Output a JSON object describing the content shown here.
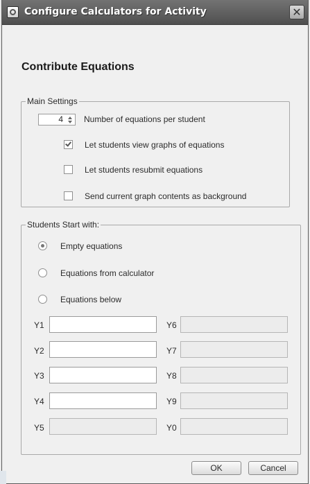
{
  "window": {
    "title": "Configure Calculators for Activity",
    "close_glyph": "✕",
    "icon": "calculator-window-icon"
  },
  "heading": "Contribute Equations",
  "main_settings": {
    "title": "Main Settings",
    "equations_per_student": {
      "value": "4",
      "label": "Number of equations per student"
    },
    "options": [
      {
        "label": "Let students view graphs of equations",
        "checked": true
      },
      {
        "label": "Let students resubmit equations",
        "checked": false
      },
      {
        "label": "Send current graph contents as background",
        "checked": false
      }
    ]
  },
  "start_with": {
    "title": "Students Start with:",
    "options": [
      {
        "label": "Empty equations",
        "selected": true
      },
      {
        "label": "Equations from calculator",
        "selected": false
      },
      {
        "label": "Equations below",
        "selected": false
      }
    ],
    "equations": {
      "left": [
        {
          "label": "Y1",
          "value": "",
          "enabled": true
        },
        {
          "label": "Y2",
          "value": "",
          "enabled": true
        },
        {
          "label": "Y3",
          "value": "",
          "enabled": true
        },
        {
          "label": "Y4",
          "value": "",
          "enabled": true
        },
        {
          "label": "Y5",
          "value": "",
          "enabled": false
        }
      ],
      "right": [
        {
          "label": "Y6",
          "value": "",
          "enabled": false
        },
        {
          "label": "Y7",
          "value": "",
          "enabled": false
        },
        {
          "label": "Y8",
          "value": "",
          "enabled": false
        },
        {
          "label": "Y9",
          "value": "",
          "enabled": false
        },
        {
          "label": "Y0",
          "value": "",
          "enabled": false
        }
      ]
    }
  },
  "buttons": {
    "ok": "OK",
    "cancel": "Cancel"
  }
}
